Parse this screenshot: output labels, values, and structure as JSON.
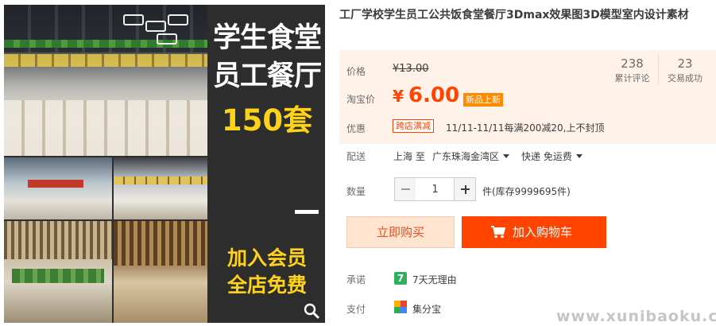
{
  "image": {
    "promo_line1": "学生食堂",
    "promo_line2": "员工餐厅",
    "promo_count": "150套",
    "promo_member1": "加入会员",
    "promo_member2": "全店免费",
    "zoom_icon": "search-icon"
  },
  "product": {
    "title": "工厂学校学生员工公共饭食堂餐厅3Dmax效果图3D模型室内设计素材"
  },
  "price": {
    "label": "价格",
    "original": "¥13.00",
    "taobao_label": "淘宝价",
    "currency": "¥",
    "current": "6.00",
    "new_badge": "新品上新",
    "accent_color": "#ff4400"
  },
  "stats": {
    "reviews_count": "238",
    "reviews_label": "累计评论",
    "deals_count": "23",
    "deals_label": "交易成功"
  },
  "promotion": {
    "label": "优惠",
    "tag": "跨店满减",
    "text": "11/11-11/11每满200减20,上不封顶"
  },
  "shipping": {
    "label": "配送",
    "from": "上海 至",
    "to": "广东珠海金湾区",
    "method": "快递 免运费"
  },
  "quantity": {
    "label": "数量",
    "value": "1",
    "stock": "件(库存9999695件)"
  },
  "actions": {
    "buy_now": "立即购买",
    "add_cart": "加入购物车"
  },
  "promise": {
    "label": "承诺",
    "icon_text": "7",
    "text": "7天无理由"
  },
  "payment": {
    "label": "支付",
    "icon": "jifenbao-icon",
    "text": "集分宝"
  },
  "watermark": "www.xunibaoku.com"
}
